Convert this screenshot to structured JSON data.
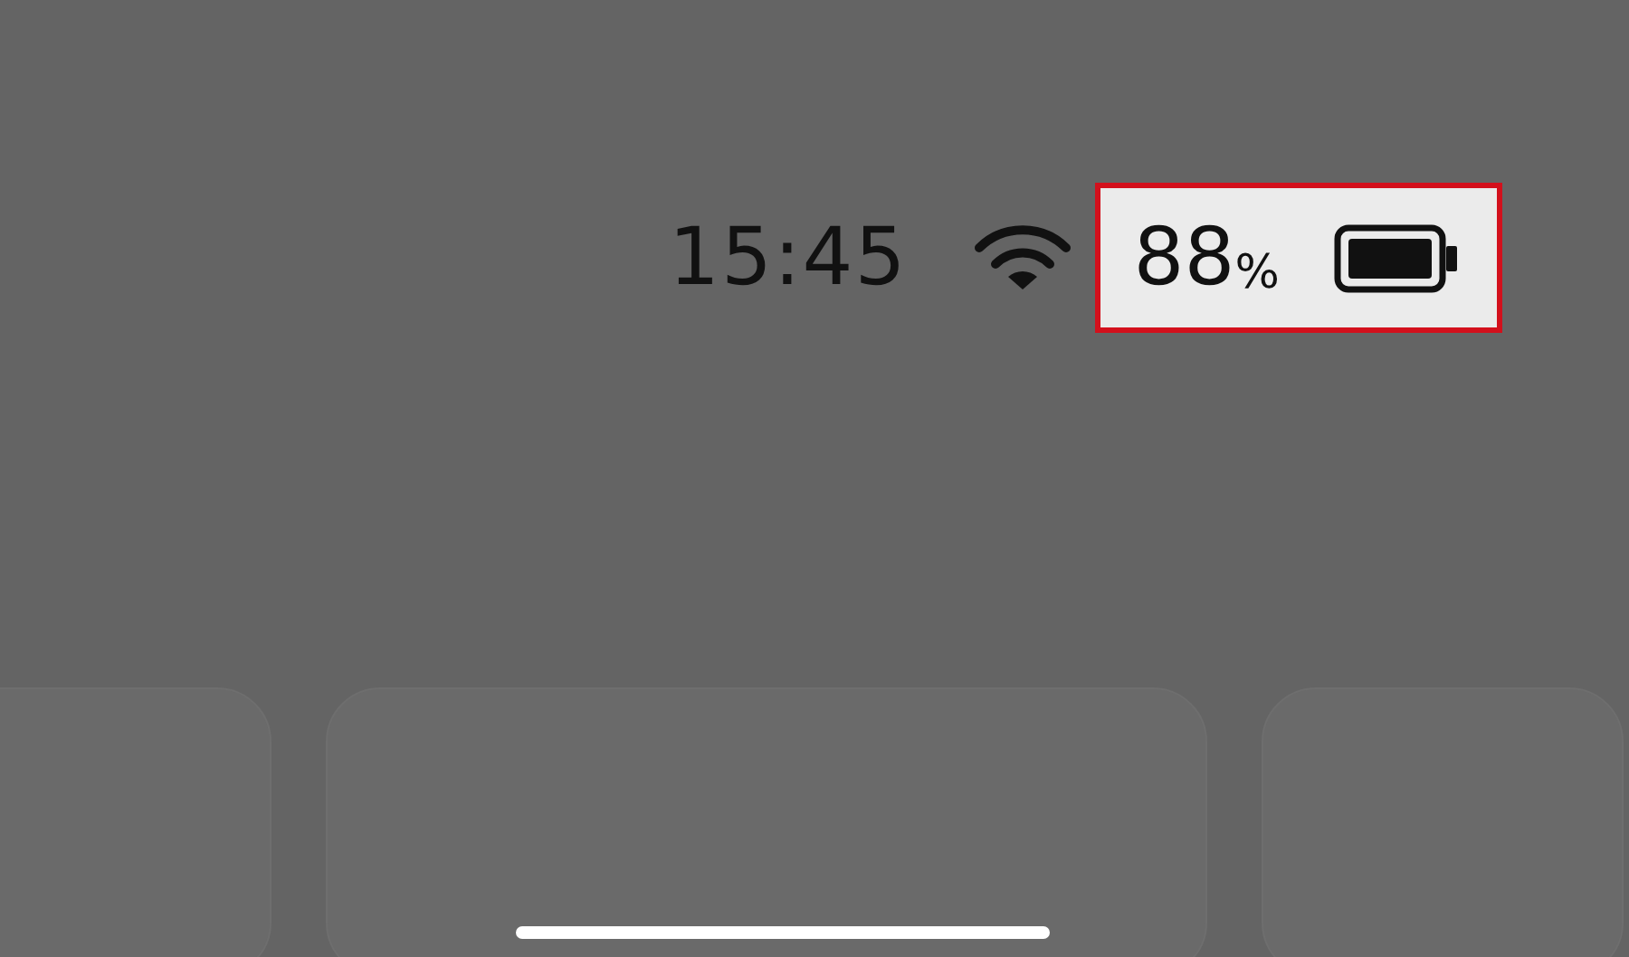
{
  "status_bar": {
    "time": "15:45",
    "battery": {
      "percent": "88",
      "unit": "%",
      "highlighted": true
    }
  }
}
